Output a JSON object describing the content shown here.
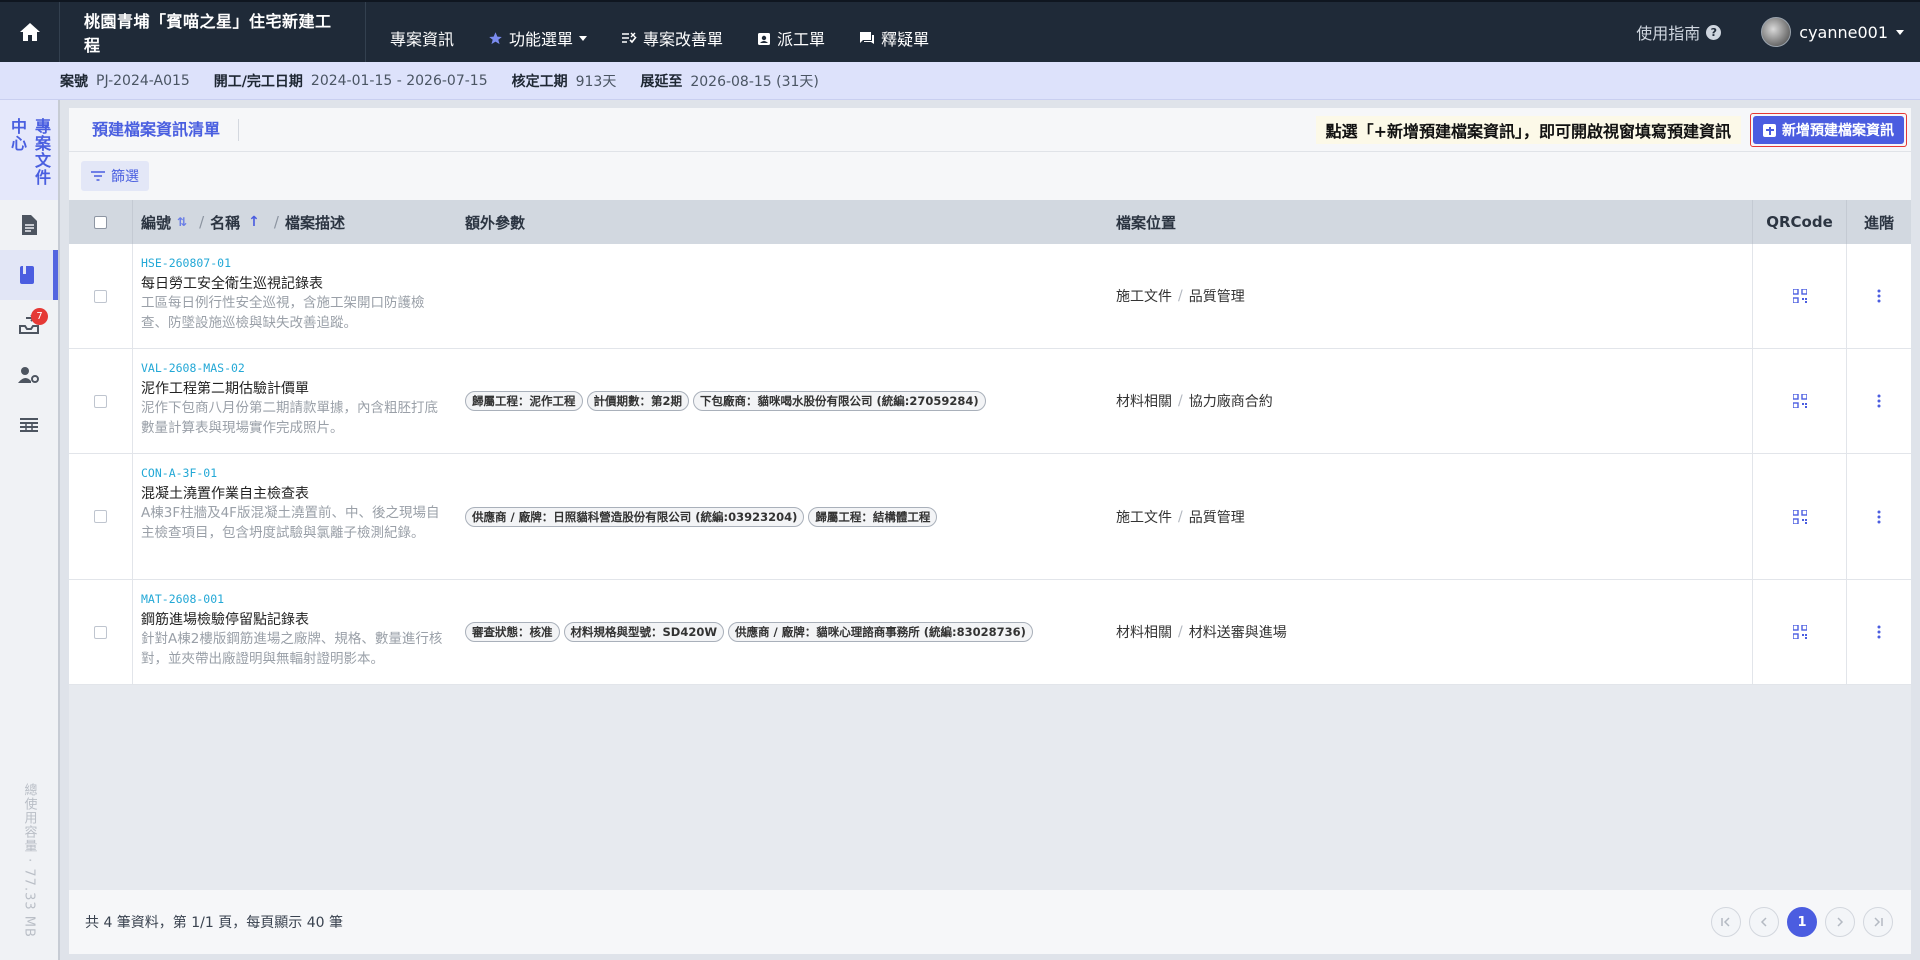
{
  "header": {
    "project_title": "桃園青埔「賓喵之星」住宅新建工程",
    "nav": [
      {
        "label": "專案資訊",
        "icon": ""
      },
      {
        "label": "功能選單",
        "icon": "star-icon"
      },
      {
        "label": "專案改善單",
        "icon": "checklist-icon"
      },
      {
        "label": "派工單",
        "icon": "badge-icon"
      },
      {
        "label": "釋疑單",
        "icon": "chat-icon"
      }
    ],
    "guide_label": "使用指南",
    "username": "cyanne001"
  },
  "info": {
    "case_label": "案號",
    "case_value": "PJ-2024-A015",
    "date_label": "開工/完工日期",
    "date_value": "2024-01-15 - 2026-07-15",
    "period_label": "核定工期",
    "period_value": "913天",
    "ext_label": "展延至",
    "ext_value": "2026-08-15 (31天)"
  },
  "sidebar": {
    "title": "專案文件中心",
    "badge": "7",
    "usage": "總使用容量 · 77.33 MB"
  },
  "panel": {
    "title": "預建檔案資訊清單",
    "hint": "點選「+新增預建檔案資訊」，即可開啟視窗填寫預建資訊",
    "add_button": "新增預建檔案資訊",
    "filter": "篩選"
  },
  "table": {
    "col_code": "編號",
    "col_name": "名稱",
    "col_desc": "檔案描述",
    "col_params": "額外參數",
    "col_location": "檔案位置",
    "col_qr": "QRCode",
    "col_adv": "進階",
    "rows": [
      {
        "code": "HSE-260807-01",
        "name": "每日勞工安全衛生巡視記錄表",
        "desc": "工區每日例行性安全巡視，含施工架開口防護檢查、防墜設施巡檢與缺失改善追蹤。",
        "params": [],
        "loc1": "施工文件",
        "loc2": "品質管理"
      },
      {
        "code": "VAL-2608-MAS-02",
        "name": "泥作工程第二期估驗計價單",
        "desc": "泥作下包商八月份第二期請款單據，內含粗胚打底數量計算表與現場實作完成照片。",
        "params": [
          "歸屬工程：泥作工程",
          "計價期數：第2期",
          "下包廠商：貓咪喝水股份有限公司 (統編:27059284)"
        ],
        "loc1": "材料相關",
        "loc2": "協力廠商合約"
      },
      {
        "code": "CON-A-3F-01",
        "name": "混凝土澆置作業自主檢查表",
        "desc": "A棟3F柱牆及4F版混凝土澆置前、中、後之現場自主檢查項目，包含坍度試驗與氯離子檢測紀錄。",
        "params": [
          "供應商 / 廠牌：日照貓科營造股份有限公司 (統編:03923204)",
          "歸屬工程：結構體工程"
        ],
        "loc1": "施工文件",
        "loc2": "品質管理"
      },
      {
        "code": "MAT-2608-001",
        "name": "鋼筋進場檢驗停留點記錄表",
        "desc": "針對A棟2樓版鋼筋進場之廠牌、規格、數量進行核對，並夾帶出廠證明與無輻射證明影本。",
        "params": [
          "審查狀態：核准",
          "材料規格與型號：SD420W",
          "供應商 / 廠牌：貓咪心理諮商事務所 (統編:83028736)"
        ],
        "loc1": "材料相關",
        "loc2": "材料送審與進場"
      }
    ]
  },
  "footer": {
    "summary": "共 4 筆資料，第 1/1 頁，每頁顯示 40 筆",
    "current_page": "1"
  },
  "colors": {
    "accent": "#4b5de0",
    "topbar": "#1f2a38",
    "code": "#23a8d6",
    "badge": "#e53935"
  }
}
